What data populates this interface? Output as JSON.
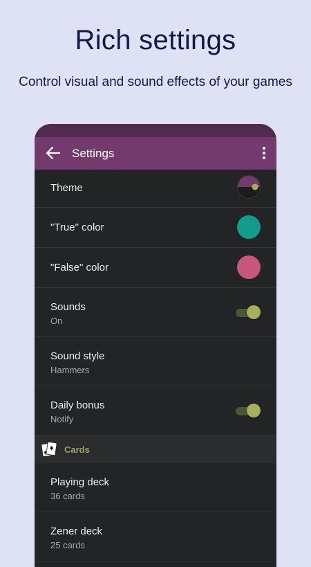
{
  "hero": {
    "title": "Rich settings",
    "subtitle": "Control visual and sound effects of your games"
  },
  "appbar": {
    "title": "Settings",
    "back_icon": "arrow-back-icon",
    "more_icon": "more-vert-icon"
  },
  "colors": {
    "page_bg": "#dfe1f5",
    "appbar": "#723a6d",
    "statusbar": "#52294f",
    "true_color": "#119c8b",
    "false_color": "#c8567a",
    "accent": "#a6b05b"
  },
  "settings": [
    {
      "label": "Theme"
    },
    {
      "label": "\"True\" color"
    },
    {
      "label": "\"False\" color"
    },
    {
      "label": "Sounds",
      "value": "On",
      "toggle": true
    },
    {
      "label": "Sound style",
      "value": "Hammers"
    },
    {
      "label": "Daily bonus",
      "value": "Notify",
      "toggle": true
    }
  ],
  "cards_section": {
    "header": "Cards",
    "icon": "playing-cards-icon",
    "items": [
      {
        "label": "Playing deck",
        "value": "36 cards"
      },
      {
        "label": "Zener deck",
        "value": "25 cards"
      }
    ]
  }
}
